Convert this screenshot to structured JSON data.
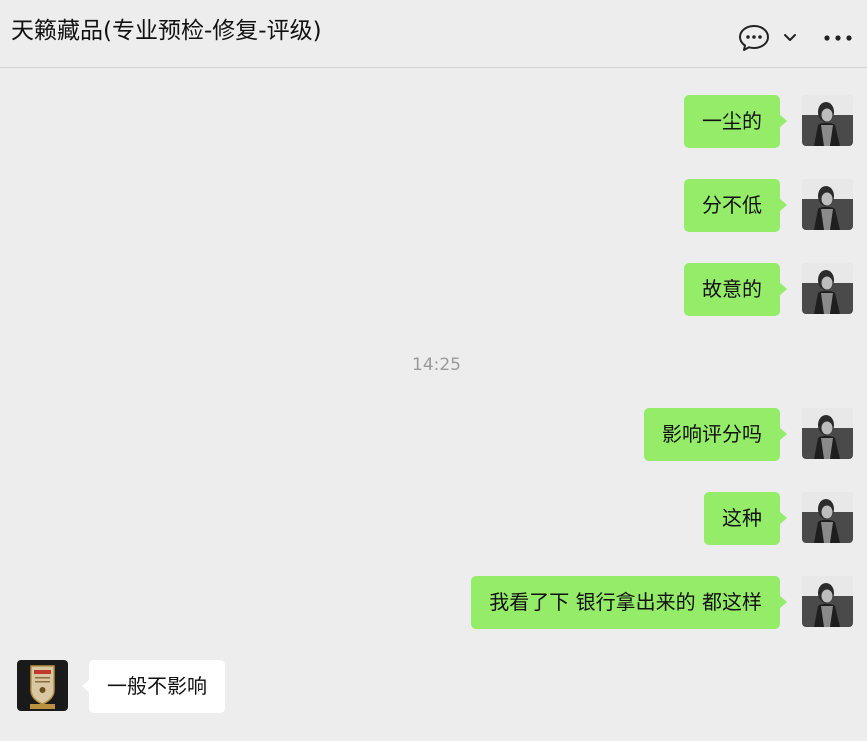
{
  "header": {
    "title": "天籁藏品(专业预检-修复-评级)",
    "icons": [
      "chat-bubble-icon",
      "chevron-down-icon",
      "more-options-icon"
    ]
  },
  "messages": [
    {
      "sender": "me",
      "text": "一尘的"
    },
    {
      "sender": "me",
      "text": "分不低"
    },
    {
      "sender": "me",
      "text": "故意的"
    },
    {
      "type": "timestamp",
      "text": "14:25"
    },
    {
      "sender": "me",
      "text": "影响评分吗"
    },
    {
      "sender": "me",
      "text": "这种"
    },
    {
      "sender": "me",
      "text": "我看了下 银行拿出来的 都这样"
    },
    {
      "sender": "them",
      "text": "一般不影响"
    }
  ],
  "colors": {
    "background": "#ededed",
    "my_bubble": "#95ec69",
    "their_bubble": "#ffffff",
    "timestamp_text": "#9a9a9a"
  }
}
